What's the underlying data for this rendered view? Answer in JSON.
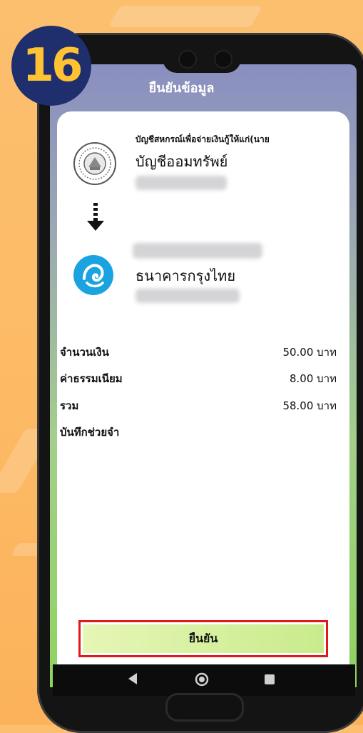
{
  "badge": {
    "number": "16"
  },
  "header": {
    "title": "ยืนยันข้อมูล"
  },
  "source": {
    "owner_name": "บัญชีสหกรณ์เพื่อจ่ายเงินกู้ให้แก่(นาย",
    "account_type": "บัญชีออมทรัพย์"
  },
  "destination": {
    "bank_name": "ธนาคารกรุงไทย"
  },
  "details": [
    {
      "label": "จำนวนเงิน",
      "value": "50.00 บาท"
    },
    {
      "label": "ค่าธรรมเนียม",
      "value": "8.00 บาท"
    },
    {
      "label": "รวม",
      "value": "58.00 บาท"
    },
    {
      "label": "บันทึกช่วยจำ",
      "value": ""
    }
  ],
  "confirm_button": {
    "label": "ยืนยัน"
  },
  "icons": {
    "bank_logo": "krungthai-logo-icon",
    "coop_logo": "coop-seal-icon",
    "arrow": "arrow-down-icon"
  },
  "colors": {
    "accent_red": "#e01919",
    "bank_blue": "#1aa3e0",
    "badge_bg": "#1f2f6e",
    "badge_text": "#ffc233"
  }
}
